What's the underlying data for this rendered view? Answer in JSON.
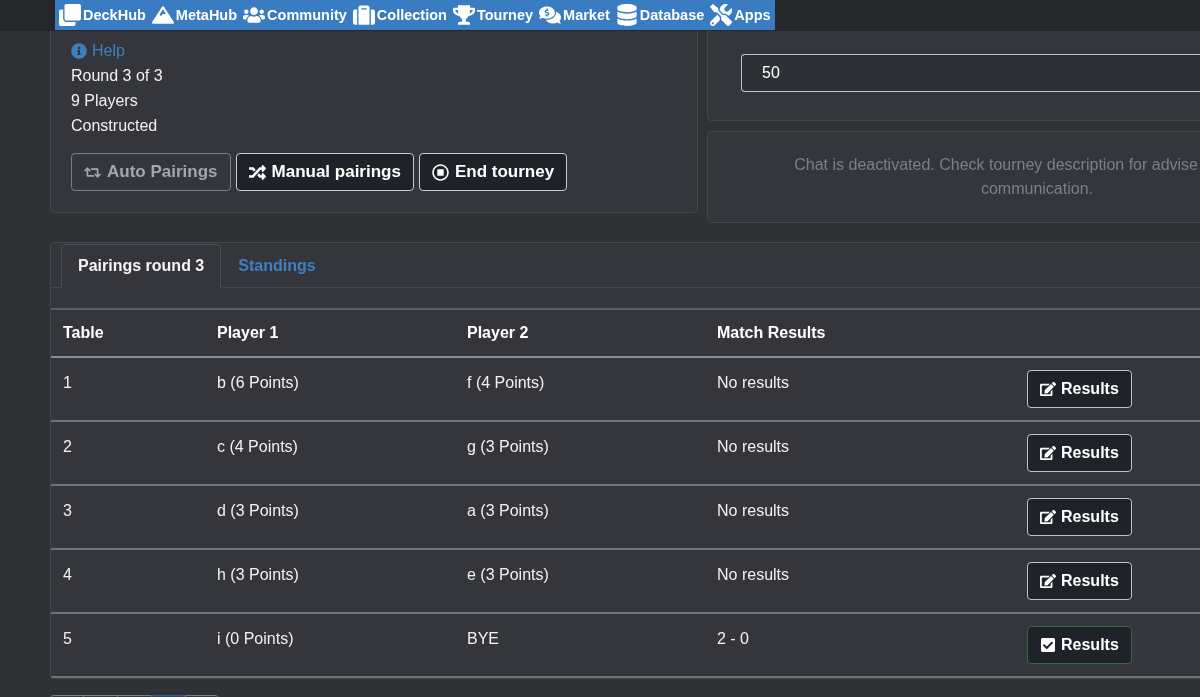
{
  "navbar": {
    "items": [
      {
        "label": "DeckHub"
      },
      {
        "label": "MetaHub"
      },
      {
        "label": "Community"
      },
      {
        "label": "Collection"
      },
      {
        "label": "Tourney"
      },
      {
        "label": "Market"
      },
      {
        "label": "Database"
      },
      {
        "label": "Apps"
      }
    ]
  },
  "info": {
    "help": "Help",
    "lines": [
      "Round 3 of 3",
      "9 Players",
      "Constructed"
    ],
    "buttons": [
      {
        "label": "Auto Pairings",
        "disabled": true
      },
      {
        "label": "Manual pairings",
        "disabled": false
      },
      {
        "label": "End tourney",
        "disabled": false
      }
    ]
  },
  "settings": {
    "value": "50"
  },
  "chat": {
    "lines": [
      "Chat is deactivated. Check tourney description for advise",
      "communication."
    ]
  },
  "tabs": [
    {
      "label": "Pairings round 3",
      "selected": true
    },
    {
      "label": "Standings",
      "selected": false
    }
  ],
  "table": {
    "columns": [
      "Table",
      "Player 1",
      "Player 2",
      "Match Results"
    ],
    "rows": [
      {
        "table": "1",
        "player_1": "b (6 Points)",
        "player_2": "f (4 Points)",
        "result": "No results",
        "button": "Results",
        "reported": false
      },
      {
        "table": "2",
        "player_1": "c (4 Points)",
        "player_2": "g (3 Points)",
        "result": "No results",
        "button": "Results",
        "reported": false
      },
      {
        "table": "3",
        "player_1": "d (3 Points)",
        "player_2": "a (3 Points)",
        "result": "No results",
        "button": "Results",
        "reported": false
      },
      {
        "table": "4",
        "player_1": "h (3 Points)",
        "player_2": "e (3 Points)",
        "result": "No results",
        "button": "Results",
        "reported": false
      },
      {
        "table": "5",
        "player_1": "i (0 Points)",
        "player_2": "BYE",
        "result": "2 - 0",
        "button": "Results",
        "reported": true
      }
    ]
  },
  "pagination": [
    {
      "selected": false
    },
    {
      "selected": false
    },
    {
      "selected": false
    },
    {
      "selected": true
    },
    {
      "selected": false
    }
  ]
}
